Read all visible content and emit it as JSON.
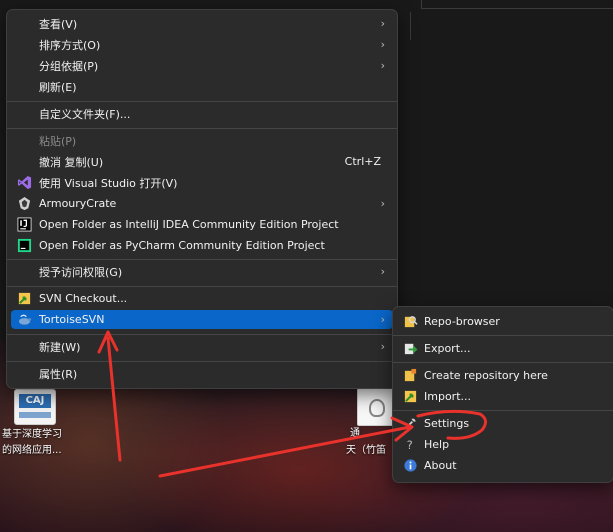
{
  "main_menu": {
    "items": [
      {
        "label": "查看(V)",
        "has_submenu": true
      },
      {
        "label": "排序方式(O)",
        "has_submenu": true
      },
      {
        "label": "分组依据(P)",
        "has_submenu": true
      },
      {
        "label": "刷新(E)"
      },
      {
        "label": "自定义文件夹(F)..."
      },
      {
        "label": "粘贴(P)",
        "disabled": true
      },
      {
        "label": "撤消 复制(U)",
        "shortcut": "Ctrl+Z"
      },
      {
        "label": "使用 Visual Studio 打开(V)",
        "icon": "visual-studio-icon"
      },
      {
        "label": "ArmouryCrate",
        "icon": "armoury-crate-icon",
        "has_submenu": true
      },
      {
        "label": "Open Folder as IntelliJ IDEA Community Edition Project",
        "icon": "intellij-idea-icon"
      },
      {
        "label": "Open Folder as PyCharm Community Edition Project",
        "icon": "pycharm-icon"
      },
      {
        "label": "授予访问权限(G)",
        "has_submenu": true
      },
      {
        "label": "SVN Checkout...",
        "icon": "svn-checkout-icon"
      },
      {
        "label": "TortoiseSVN",
        "icon": "tortoise-svn-icon",
        "has_submenu": true,
        "selected": true
      },
      {
        "label": "新建(W)",
        "has_submenu": true
      },
      {
        "label": "属性(R)"
      }
    ],
    "arrow_glyph": "›"
  },
  "tortoise_submenu": {
    "items": [
      {
        "label": "Repo-browser",
        "icon": "repo-browser-icon"
      },
      {
        "label": "Export...",
        "icon": "export-icon"
      },
      {
        "label": "Create repository here",
        "icon": "create-repository-icon"
      },
      {
        "label": "Import...",
        "icon": "import-icon"
      },
      {
        "label": "Settings",
        "icon": "settings-icon"
      },
      {
        "label": "Help",
        "icon": "help-icon"
      },
      {
        "label": "About",
        "icon": "about-icon"
      }
    ]
  },
  "desktop": {
    "caj_icon_label": "CAJ",
    "caj_caption_line1": "基于深度学习",
    "caj_caption_line2": "的网络应用...",
    "file_caption_line1": "通",
    "file_caption_line2": "天（竹笛"
  },
  "colors": {
    "menu_bg": "#2b2b2b",
    "selected": "#0a66c8",
    "annotation": "#e8322b"
  }
}
